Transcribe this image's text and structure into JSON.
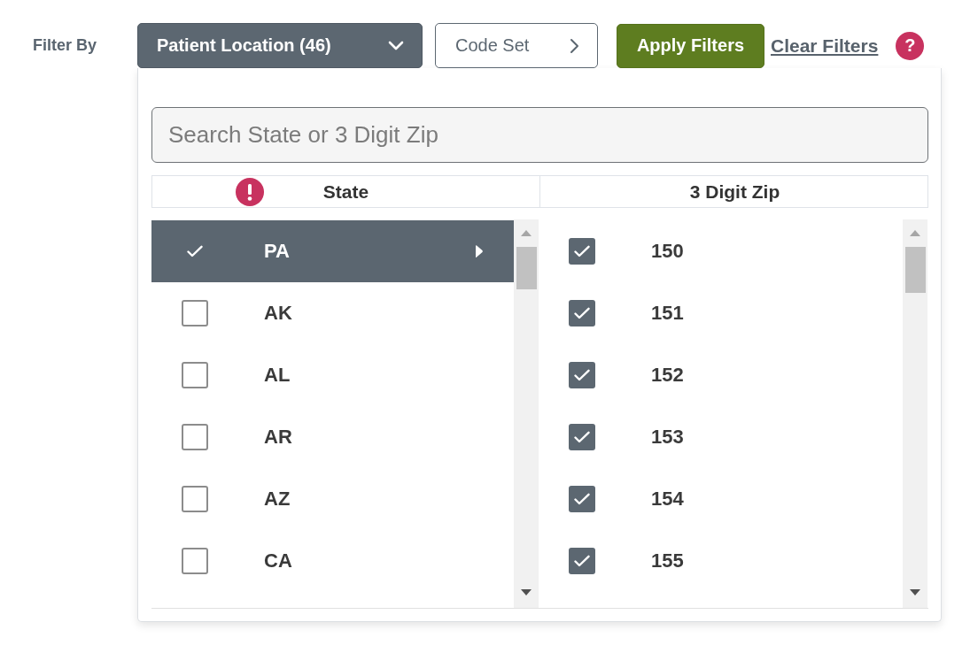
{
  "filter_bar": {
    "label": "Filter By",
    "location_dropdown": {
      "label": "Patient Location (46)",
      "expanded": true
    },
    "code_set_button": "Code Set",
    "apply_button": "Apply Filters",
    "clear_link": "Clear Filters",
    "help_button": "?"
  },
  "panel": {
    "search": {
      "placeholder": "Search State or 3 Digit Zip"
    },
    "columns": [
      {
        "label": "State",
        "warning": true
      },
      {
        "label": "3 Digit Zip",
        "warning": false
      }
    ],
    "states": [
      {
        "label": "PA",
        "checked": true,
        "selected": true
      },
      {
        "label": "AK",
        "checked": false,
        "selected": false
      },
      {
        "label": "AL",
        "checked": false,
        "selected": false
      },
      {
        "label": "AR",
        "checked": false,
        "selected": false
      },
      {
        "label": "AZ",
        "checked": false,
        "selected": false
      },
      {
        "label": "CA",
        "checked": false,
        "selected": false
      }
    ],
    "zips": [
      {
        "label": "150",
        "checked": true
      },
      {
        "label": "151",
        "checked": true
      },
      {
        "label": "152",
        "checked": true
      },
      {
        "label": "153",
        "checked": true
      },
      {
        "label": "154",
        "checked": true
      },
      {
        "label": "155",
        "checked": true
      }
    ]
  }
}
